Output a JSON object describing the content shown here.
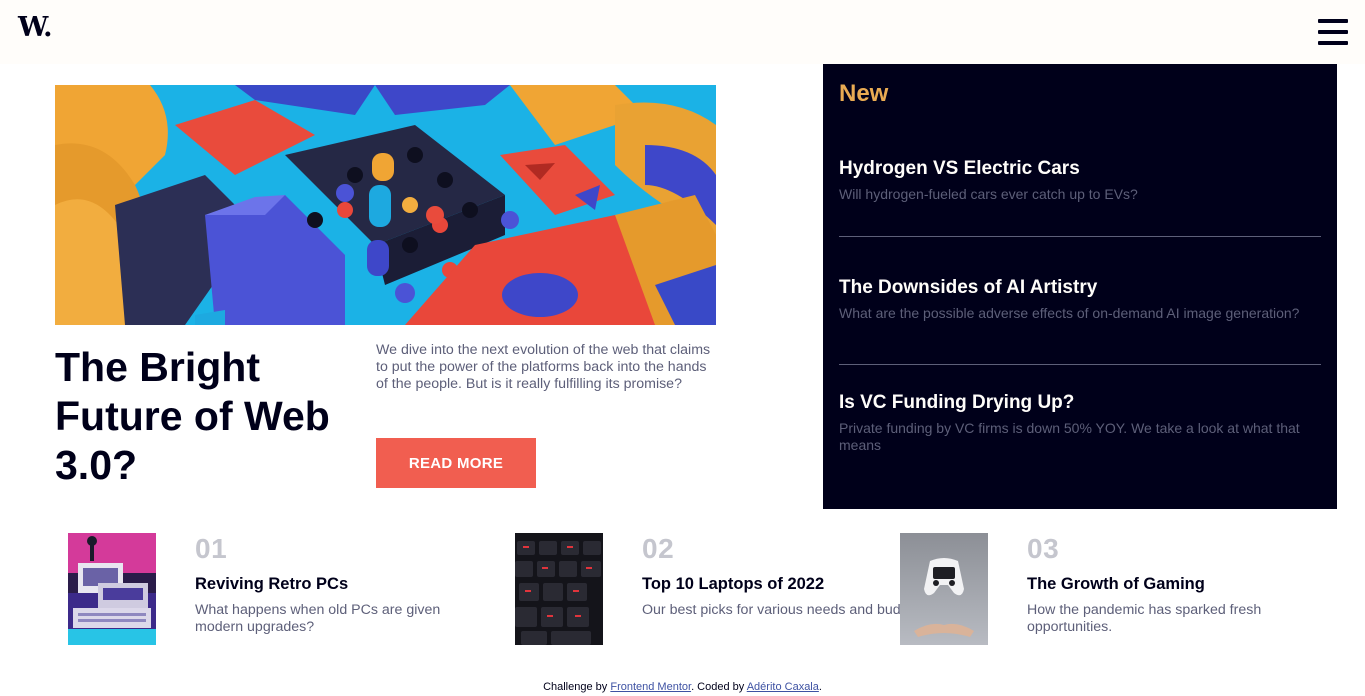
{
  "header": {
    "logo_text": "W.",
    "menu_icon": "hamburger-menu-icon"
  },
  "hero": {
    "image_description_icon": "abstract-3d-blocks-image",
    "title": "The Bright Future of Web 3.0?",
    "description": "We dive into the next evolution of the web that claims to put the power of the platforms back into the hands of the people. But is it really fulfilling its promise?",
    "button_label": "READ MORE"
  },
  "new_panel": {
    "heading": "New",
    "items": [
      {
        "title": "Hydrogen VS Electric Cars",
        "description": "Will hydrogen-fueled cars ever catch up to EVs?"
      },
      {
        "title": "The Downsides of AI Artistry",
        "description": "What are the possible adverse effects of on-demand AI image generation?"
      },
      {
        "title": "Is VC Funding Drying Up?",
        "description": "Private funding by VC firms is down 50% YOY. We take a look at what that means"
      }
    ]
  },
  "bottom_articles": [
    {
      "number": "01",
      "title": "Reviving Retro PCs",
      "description": "What happens when old PCs are given modern upgrades?"
    },
    {
      "number": "02",
      "title": "Top 10 Laptops of 2022",
      "description": "Our best picks for various needs and budgets."
    },
    {
      "number": "03",
      "title": "The Growth of Gaming",
      "description": "How the pandemic has sparked fresh opportunities."
    }
  ],
  "footer": {
    "prefix": "Challenge by ",
    "link1": "Frontend Mentor",
    "middle": ". Coded by ",
    "link2": "Adérito Caxala",
    "suffix": "."
  },
  "colors": {
    "accent_red": "#f15e50",
    "accent_orange": "#e9ab53",
    "dark_navy": "#00001a",
    "grayish_blue": "#5d5f79",
    "off_white": "#fffdfa"
  }
}
